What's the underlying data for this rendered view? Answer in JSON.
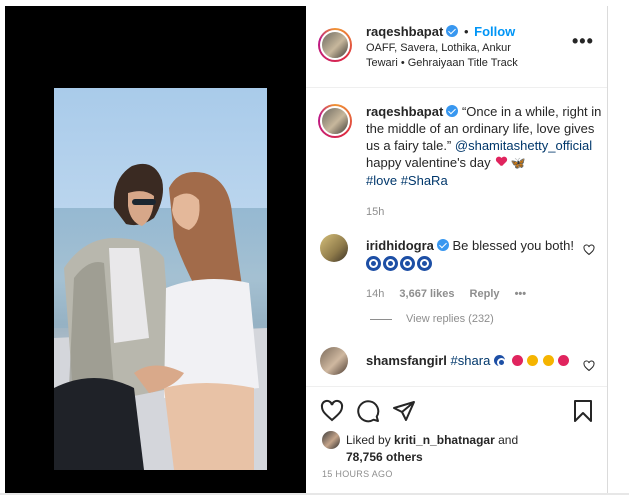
{
  "post": {
    "username": "raqeshbapat",
    "follow_label": "Follow",
    "location_line": "OAFF, Savera, Lothika, Ankur Tewari • Gehraiyaan Title Track",
    "more_icon": "more-horizontal-icon"
  },
  "caption": {
    "username": "raqeshbapat",
    "text": "“Once in a while, right in the middle of an ordinary life, love gives us a fairy tale.”",
    "mention": "@shamitashetty_official",
    "line2": "happy valentine's day",
    "hashtags": "#love #ShaRa",
    "time": "15h"
  },
  "comments": [
    {
      "username": "iridhidogra",
      "text": "Be blessed you both!",
      "time": "14h",
      "likes": "3,667 likes",
      "reply_label": "Reply",
      "view_replies": "View replies (232)"
    },
    {
      "username": "shamsfangirl",
      "text": "#shara"
    }
  ],
  "likes": {
    "prefix": "Liked by",
    "user": "kriti_n_bhatnagar",
    "joiner": "and",
    "others": "78,756 others"
  },
  "posted_ago": "15 HOURS AGO",
  "colors": {
    "follow_blue": "#0095f6",
    "verified_blue": "#3897f0",
    "link": "#00376b",
    "secondary": "#8e8e8e"
  }
}
